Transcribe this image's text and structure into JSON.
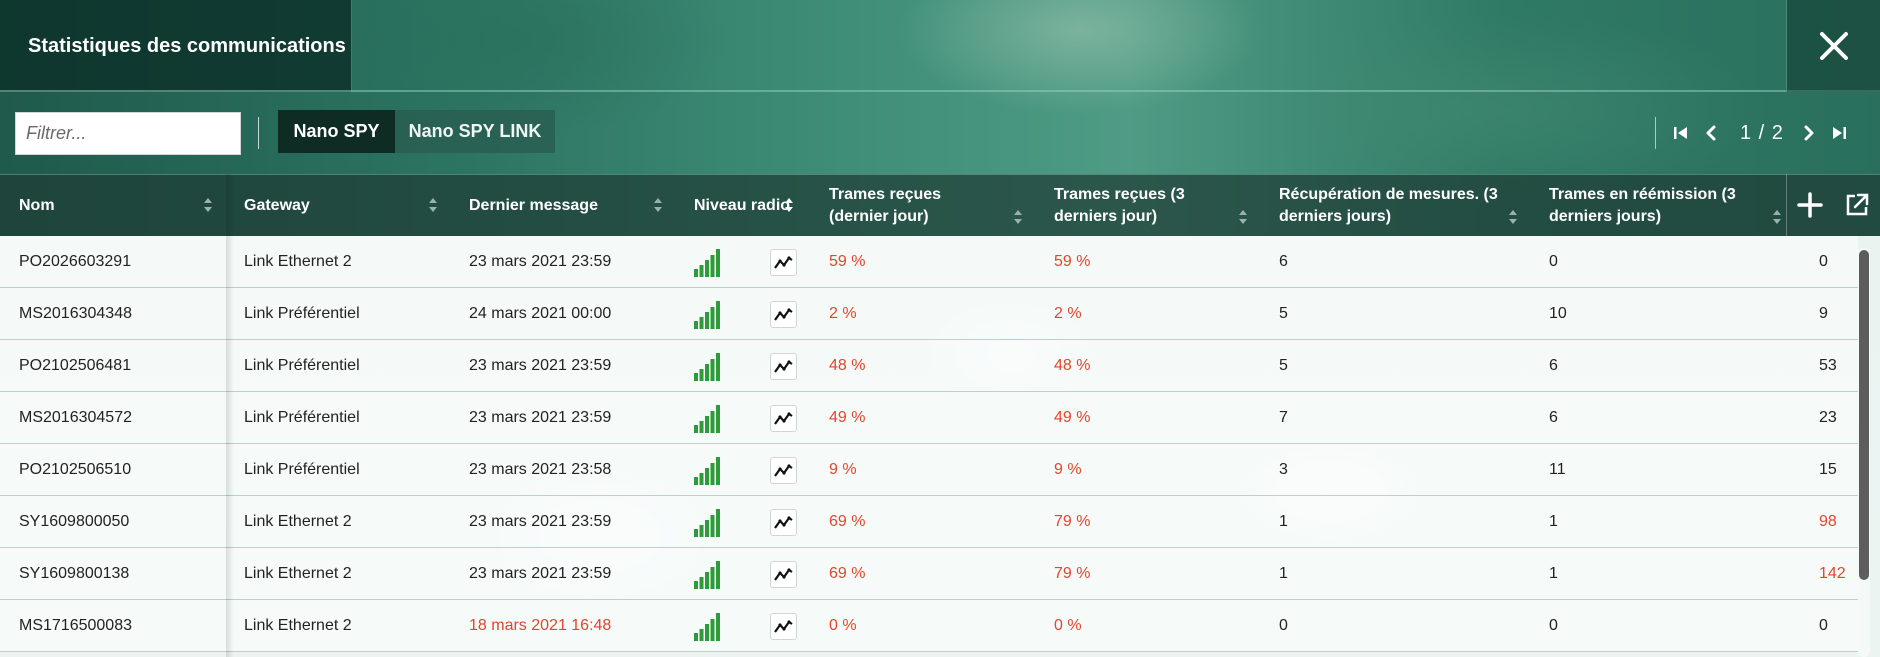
{
  "window": {
    "title": "Statistiques des communications"
  },
  "toolbar": {
    "filter_placeholder": "Filtrer...",
    "tabs": [
      {
        "label": "Nano SPY",
        "active": true
      },
      {
        "label": "Nano SPY LINK",
        "active": false
      }
    ]
  },
  "pager": {
    "label": "1 / 2",
    "current_page": 1,
    "total_pages": 2
  },
  "table": {
    "columns": [
      {
        "label": "Nom",
        "sortable": true
      },
      {
        "label": "Gateway",
        "sortable": true
      },
      {
        "label": "Dernier message",
        "sortable": true
      },
      {
        "label": "Niveau radio",
        "sortable": true
      },
      {
        "label": "Trames reçues (dernier jour)",
        "sortable": true
      },
      {
        "label": "Trames reçues (3 derniers jour)",
        "sortable": true
      },
      {
        "label": "Récupération de mesures. (3 derniers jours)",
        "sortable": true
      },
      {
        "label": "Trames en réémission (3 derniers jours)",
        "sortable": true
      }
    ],
    "rows": [
      {
        "nom": "PO2026603291",
        "gateway": "Link Ethernet 2",
        "dernier_message": "23 mars 2021 23:59",
        "message_alert": false,
        "radio_level": 5,
        "trames_jour": "59 %",
        "trames_3j": "59 %",
        "recup": "6",
        "reemission": "0",
        "last": "0",
        "last_alert": false
      },
      {
        "nom": "MS2016304348",
        "gateway": "Link Préférentiel",
        "dernier_message": "24 mars 2021 00:00",
        "message_alert": false,
        "radio_level": 5,
        "trames_jour": "2 %",
        "trames_3j": "2 %",
        "recup": "5",
        "reemission": "10",
        "last": "9",
        "last_alert": false
      },
      {
        "nom": "PO2102506481",
        "gateway": "Link Préférentiel",
        "dernier_message": "23 mars 2021 23:59",
        "message_alert": false,
        "radio_level": 5,
        "trames_jour": "48 %",
        "trames_3j": "48 %",
        "recup": "5",
        "reemission": "6",
        "last": "53",
        "last_alert": false
      },
      {
        "nom": "MS2016304572",
        "gateway": "Link Préférentiel",
        "dernier_message": "23 mars 2021 23:59",
        "message_alert": false,
        "radio_level": 5,
        "trames_jour": "49 %",
        "trames_3j": "49 %",
        "recup": "7",
        "reemission": "6",
        "last": "23",
        "last_alert": false
      },
      {
        "nom": "PO2102506510",
        "gateway": "Link Préférentiel",
        "dernier_message": "23 mars 2021 23:58",
        "message_alert": false,
        "radio_level": 5,
        "trames_jour": "9 %",
        "trames_3j": "9 %",
        "recup": "3",
        "reemission": "11",
        "last": "15",
        "last_alert": false
      },
      {
        "nom": "SY1609800050",
        "gateway": "Link Ethernet 2",
        "dernier_message": "23 mars 2021 23:59",
        "message_alert": false,
        "radio_level": 5,
        "trames_jour": "69 %",
        "trames_3j": "79 %",
        "recup": "1",
        "reemission": "1",
        "last": "98",
        "last_alert": true
      },
      {
        "nom": "SY1609800138",
        "gateway": "Link Ethernet 2",
        "dernier_message": "23 mars 2021 23:59",
        "message_alert": false,
        "radio_level": 5,
        "trames_jour": "69 %",
        "trames_3j": "79 %",
        "recup": "1",
        "reemission": "1",
        "last": "142",
        "last_alert": true
      },
      {
        "nom": "MS1716500083",
        "gateway": "Link Ethernet 2",
        "dernier_message": "18 mars 2021 16:48",
        "message_alert": true,
        "radio_level": 5,
        "trames_jour": "0 %",
        "trames_3j": "0 %",
        "recup": "0",
        "reemission": "0",
        "last": "0",
        "last_alert": false
      }
    ]
  },
  "icons": {
    "close": "close-icon",
    "first_page": "first-page-icon",
    "prev_page": "prev-page-icon",
    "next_page": "next-page-icon",
    "last_page": "last-page-icon",
    "add": "plus-icon",
    "export": "external-link-icon",
    "sort": "sort-icon",
    "signal": "signal-bars-icon",
    "graph": "line-chart-icon"
  },
  "colors": {
    "alert": "#e2452d",
    "signal": "#2e9a3a",
    "row_border": "#a6dccb"
  }
}
